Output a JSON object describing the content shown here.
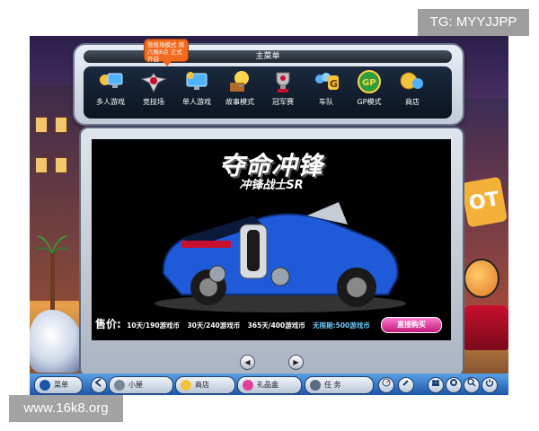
{
  "watermarks": {
    "top": "TG: MYYJJPP",
    "bottom": "www.16k8.org"
  },
  "tooltip": "竞技场模式 周六晚8点 正式开启",
  "menu": {
    "title": "主菜单",
    "items": [
      {
        "label": "多人游戏",
        "icon": "monitor-group-icon"
      },
      {
        "label": "竞技场",
        "icon": "winged-helmet-icon"
      },
      {
        "label": "单人游戏",
        "icon": "monitor-single-icon"
      },
      {
        "label": "故事模式",
        "icon": "book-lightbulb-icon"
      },
      {
        "label": "冠军赛",
        "icon": "trophy-icon"
      },
      {
        "label": "车队",
        "icon": "team-g-icon"
      },
      {
        "label": "GP模式",
        "icon": "gp-badge-icon"
      },
      {
        "label": "商店",
        "icon": "shop-coin-icon"
      }
    ]
  },
  "showcase": {
    "title": "夺命冲锋",
    "subtitle": "冲锋战士SR",
    "price_label": "售价:",
    "options": [
      "10天/190游戏币",
      "30天/240游戏币",
      "365天/400游戏币"
    ],
    "unlimited": "无限期:500游戏币",
    "buy_label": "直接购买",
    "prev_label": "◀",
    "next_label": "▶"
  },
  "taskbar": {
    "menu_label": "菜单",
    "room_label": "小屋",
    "shop_label": "商店",
    "gift_label": "礼品盒",
    "task_label": "任 务"
  },
  "colors": {
    "accent": "#f26a1e",
    "buy": "#e0409c",
    "car": "#1f5ad8"
  }
}
